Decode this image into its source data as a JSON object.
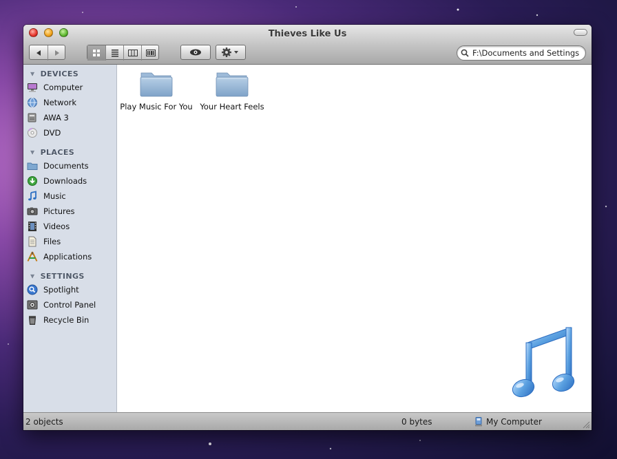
{
  "window": {
    "title": "Thieves Like Us"
  },
  "toolbar": {
    "back_icon": "arrow-left-icon",
    "forward_icon": "arrow-right-icon",
    "view_modes": [
      "icon-view",
      "list-view",
      "column-view",
      "coverflow-view"
    ],
    "active_view": "icon-view",
    "quicklook_icon": "eye-icon",
    "action_icon": "gear-icon"
  },
  "search": {
    "value": "F:\\Documents and Settings\\"
  },
  "sidebar": {
    "sections": [
      {
        "title": "DEVICES",
        "items": [
          {
            "label": "Computer",
            "icon": "computer-icon"
          },
          {
            "label": "Network",
            "icon": "network-icon"
          },
          {
            "label": "AWA 3",
            "icon": "drive-icon"
          },
          {
            "label": "DVD",
            "icon": "dvd-icon"
          }
        ]
      },
      {
        "title": "PLACES",
        "items": [
          {
            "label": "Documents",
            "icon": "folder-icon"
          },
          {
            "label": "Downloads",
            "icon": "download-icon"
          },
          {
            "label": "Music",
            "icon": "music-note-icon"
          },
          {
            "label": "Pictures",
            "icon": "camera-icon"
          },
          {
            "label": "Videos",
            "icon": "film-icon"
          },
          {
            "label": "Files",
            "icon": "file-icon"
          },
          {
            "label": "Applications",
            "icon": "applications-icon"
          }
        ]
      },
      {
        "title": "SETTINGS",
        "items": [
          {
            "label": "Spotlight",
            "icon": "spotlight-icon"
          },
          {
            "label": "Control Panel",
            "icon": "control-panel-icon"
          },
          {
            "label": "Recycle Bin",
            "icon": "trash-icon"
          }
        ]
      }
    ]
  },
  "content": {
    "folders": [
      {
        "label": "Play Music For You"
      },
      {
        "label": "Your Heart Feels"
      }
    ],
    "watermark_icon": "music-note-icon"
  },
  "statusbar": {
    "count": "2 objects",
    "size": "0 bytes",
    "location": "My Computer"
  },
  "colors": {
    "sidebar_bg": "#d8dee8",
    "folder_blue": "#8fb3d4",
    "music_blue": "#5aa0e0"
  }
}
